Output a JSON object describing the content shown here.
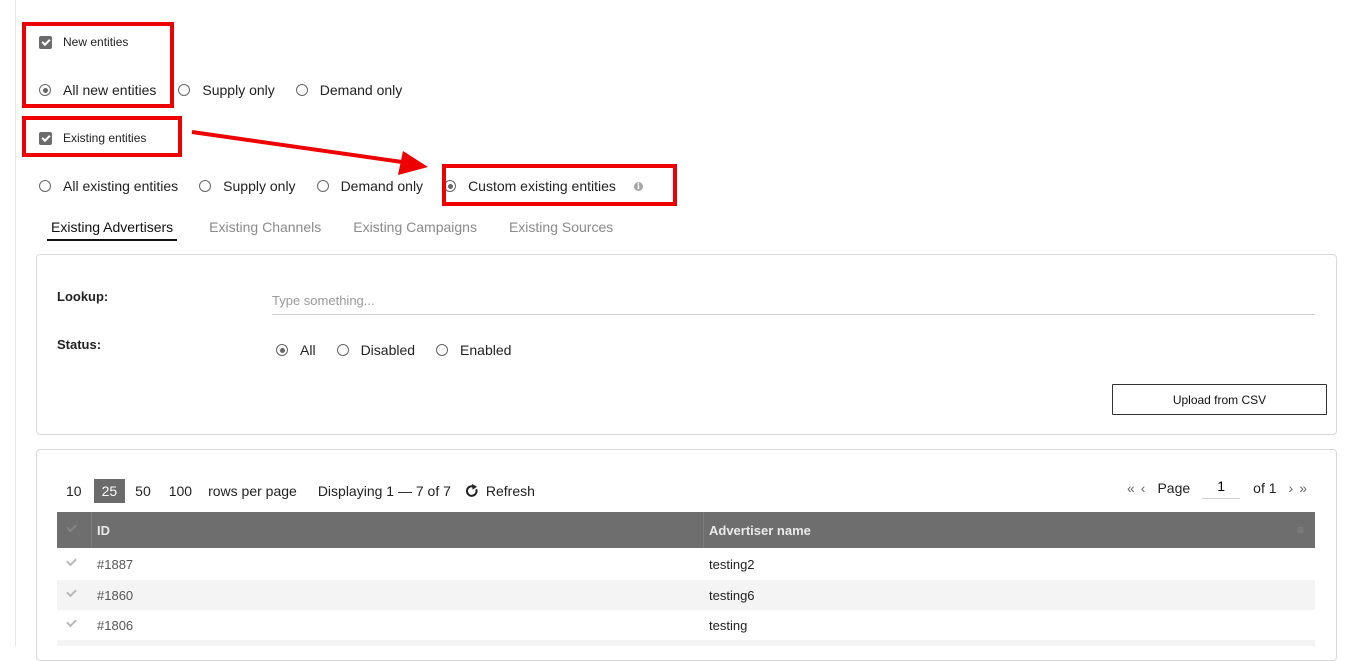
{
  "new_entities": {
    "checkbox_label": "New entities",
    "options": [
      "All new entities",
      "Supply only",
      "Demand only"
    ]
  },
  "existing_entities": {
    "checkbox_label": "Existing entities",
    "options": [
      "All existing entities",
      "Supply only",
      "Demand only",
      "Custom existing entities"
    ]
  },
  "tabs": [
    "Existing Advertisers",
    "Existing Channels",
    "Existing Campaigns",
    "Existing Sources"
  ],
  "filters": {
    "lookup_label": "Lookup:",
    "lookup_placeholder": "Type something...",
    "status_label": "Status:",
    "status_options": [
      "All",
      "Disabled",
      "Enabled"
    ],
    "upload_button": "Upload from CSV"
  },
  "pagination": {
    "sizes": [
      "10",
      "25",
      "50",
      "100"
    ],
    "rows_per_page": "rows per page",
    "displaying": "Displaying 1 — 7 of 7",
    "refresh": "Refresh",
    "page_label": "Page",
    "page_value": "1",
    "of_label": "of 1"
  },
  "table": {
    "columns": [
      "ID",
      "Advertiser name"
    ],
    "rows": [
      {
        "id": "#1887",
        "name": "testing2"
      },
      {
        "id": "#1860",
        "name": "testing6"
      },
      {
        "id": "#1806",
        "name": "testing"
      }
    ]
  },
  "colors": {
    "annotation_red": "#ee0000",
    "header_gray": "#6e6e6e"
  }
}
